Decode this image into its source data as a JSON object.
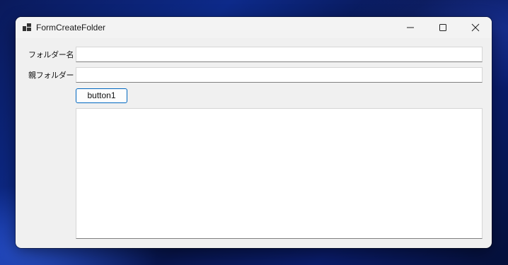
{
  "window": {
    "title": "FormCreateFolder"
  },
  "form": {
    "folder_name_label": "フォルダー名",
    "folder_name_value": "",
    "parent_folder_label": "親フォルダー",
    "parent_folder_value": "",
    "button_label": "button1",
    "output_text": ""
  },
  "icons": {
    "app": "app-window-icon",
    "minimize": "minimize-icon",
    "maximize": "maximize-icon",
    "close": "close-icon"
  },
  "colors": {
    "accent": "#0067c0",
    "window_bg": "#f0f0f0"
  }
}
